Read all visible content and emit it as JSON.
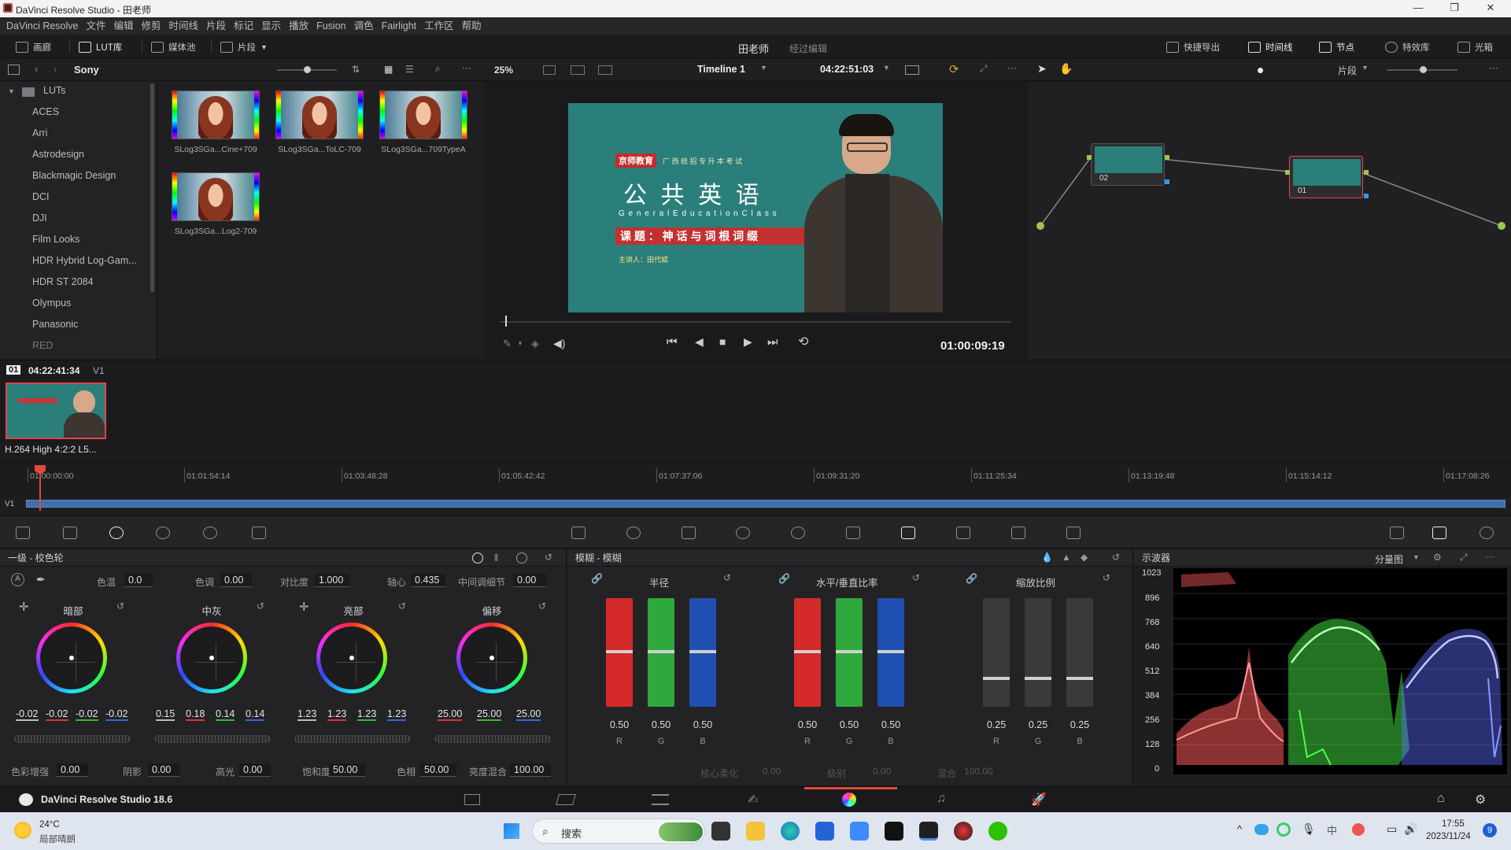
{
  "window": {
    "title": "DaVinci Resolve Studio - 田老师",
    "min": "—",
    "max": "❐",
    "close": "✕"
  },
  "menu": [
    "DaVinci Resolve",
    "文件",
    "编辑",
    "修剪",
    "时间线",
    "片段",
    "标记",
    "显示",
    "播放",
    "Fusion",
    "调色",
    "Fairlight",
    "工作区",
    "帮助"
  ],
  "toolbar": {
    "gallery": "画廊",
    "lut": "LUT库",
    "media_pool": "媒体池",
    "clips": "片段",
    "project": "田老师",
    "project_status": "经过编辑",
    "quick_export": "快捷导出",
    "timeline": "时间线",
    "nodes": "节点",
    "effects": "特效库",
    "lightbox": "光箱"
  },
  "bar2": {
    "folder": "Sony",
    "zoom": "25%",
    "timeline_name": "Timeline 1",
    "timecode": "04:22:51:03",
    "clip_mode": "片段"
  },
  "lut_tree": {
    "root": "LUTs",
    "items": [
      "ACES",
      "Arri",
      "Astrodesign",
      "Blackmagic Design",
      "DCI",
      "DJI",
      "Film Looks",
      "HDR Hybrid Log-Gam...",
      "HDR ST 2084",
      "Olympus",
      "Panasonic",
      "RED"
    ]
  },
  "luts": [
    {
      "label": "SLog3SGa...Cine+709"
    },
    {
      "label": "SLog3SGa...ToLC-709"
    },
    {
      "label": "SLog3SGa...709TypeA"
    },
    {
      "label": "SLog3SGa...Log2-709"
    }
  ],
  "viewer": {
    "playhead_timecode": "01:00:09:19",
    "video_logo": "京师教育",
    "video_top_line": "广 西 统 招 专 升 本 考 试",
    "video_title": "公 共 英 语",
    "video_subtitle": "G e n e r a l   E d u c a t i o n   C l a s s",
    "video_topic": "课 题 ： 神 话 与 词 根 词 缀",
    "video_teacher": "主讲人：田代斌"
  },
  "nodes": [
    {
      "label": "02"
    },
    {
      "label": "01"
    }
  ],
  "clip": {
    "index": "01",
    "timecode": "04:22:41:34",
    "track": "V1",
    "codec": "H.264 High 4:2:2 L5..."
  },
  "ruler": {
    "ticks": [
      "01:00:00:00",
      "01:01:54:14",
      "01:03:48:28",
      "01:05:42:42",
      "01:07:37:06",
      "01:09:31:20",
      "01:11:25:34",
      "01:13:19:48",
      "01:15:14:12",
      "01:17:08:26"
    ],
    "track": "V1"
  },
  "primaries": {
    "title": "一级 - 校色轮",
    "temp_label": "色温",
    "temp": "0.0",
    "tint_label": "色调",
    "tint": "0.00",
    "contrast_label": "对比度",
    "contrast": "1.000",
    "pivot_label": "轴心",
    "pivot": "0.435",
    "mid_detail_label": "中间调细节",
    "mid_detail": "0.00",
    "wheels": [
      {
        "label": "暗部",
        "values": [
          "-0.02",
          "-0.02",
          "-0.02",
          "-0.02"
        ]
      },
      {
        "label": "中灰",
        "values": [
          "0.15",
          "0.18",
          "0.14",
          "0.14"
        ]
      },
      {
        "label": "亮部",
        "values": [
          "1.23",
          "1.23",
          "1.23",
          "1.23"
        ]
      },
      {
        "label": "偏移",
        "values": [
          "25.00",
          "25.00",
          "25.00"
        ]
      }
    ],
    "color_boost_label": "色彩增强",
    "color_boost": "0.00",
    "shadows_label": "阴影",
    "shadows": "0.00",
    "highlights_label": "高光",
    "highlights": "0.00",
    "saturation_label": "饱和度",
    "saturation": "50.00",
    "hue_label": "色相",
    "hue": "50.00",
    "lum_mix_label": "亮度混合",
    "lum_mix": "100.00"
  },
  "blur": {
    "title": "模糊 - 模糊",
    "radius_label": "半径",
    "radius": [
      "0.50",
      "0.50",
      "0.50"
    ],
    "hv_label": "水平/垂直比率",
    "hv": [
      "0.50",
      "0.50",
      "0.50"
    ],
    "scale_label": "缩放比例",
    "scale": [
      "0.25",
      "0.25",
      "0.25"
    ],
    "channels": [
      "R",
      "G",
      "B"
    ],
    "core_soft_label": "核心柔化",
    "core_soft": "0.00",
    "level_label": "级别",
    "level": "0.00",
    "mix_label": "混合",
    "mix": "100.00"
  },
  "scope": {
    "title": "示波器",
    "mode": "分量图",
    "y_labels": [
      "1023",
      "896",
      "768",
      "640",
      "512",
      "384",
      "256",
      "128",
      "0"
    ]
  },
  "footer": {
    "app": "DaVinci Resolve Studio 18.6"
  },
  "taskbar": {
    "temp": "24°C",
    "weather": "局部晴朗",
    "search": "搜索",
    "time": "17:55",
    "date": "2023/11/24",
    "badge": "9"
  },
  "colors": {
    "accent": "#e8463c",
    "red": "#d42a2a",
    "green": "#2fa83c",
    "blue": "#1f4fb0"
  }
}
